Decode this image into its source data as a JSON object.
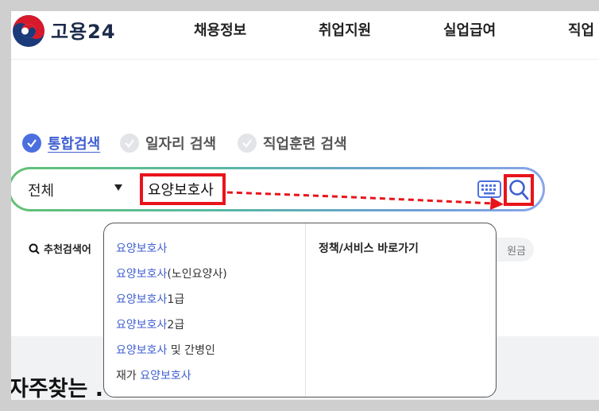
{
  "header": {
    "logo_text": "고용24",
    "nav": [
      "채용정보",
      "취업지원",
      "실업급여",
      "직업"
    ]
  },
  "search_tabs": [
    {
      "label": "통합검색",
      "active": true
    },
    {
      "label": "일자리 검색",
      "active": false
    },
    {
      "label": "직업훈련 검색",
      "active": false
    }
  ],
  "search": {
    "scope": "전체",
    "query": "요양보호사",
    "keyboard_icon": "keyboard-icon",
    "search_icon": "search-icon"
  },
  "recommended": {
    "label": "추천검색어",
    "partial_chip": "원금"
  },
  "autocomplete": {
    "suggestions": [
      {
        "prefix": "",
        "match": "요양보호사",
        "suffix": ""
      },
      {
        "prefix": "",
        "match": "요양보호사",
        "suffix": "(노인요양사)"
      },
      {
        "prefix": "",
        "match": "요양보호사",
        "suffix": "1급"
      },
      {
        "prefix": "",
        "match": "요양보호사",
        "suffix": "2급"
      },
      {
        "prefix": "",
        "match": "요양보호사",
        "suffix": " 및 간병인"
      },
      {
        "prefix": "재가 ",
        "match": "요양보호사",
        "suffix": ""
      }
    ],
    "right_title": "정책/서비스 바로가기"
  },
  "faq": {
    "title": "자주찾는 ."
  },
  "colors": {
    "accent": "#3f5fd0",
    "highlight_border": "#e8141b",
    "gradient_start": "#62c274",
    "gradient_end": "#8aa6e6"
  }
}
